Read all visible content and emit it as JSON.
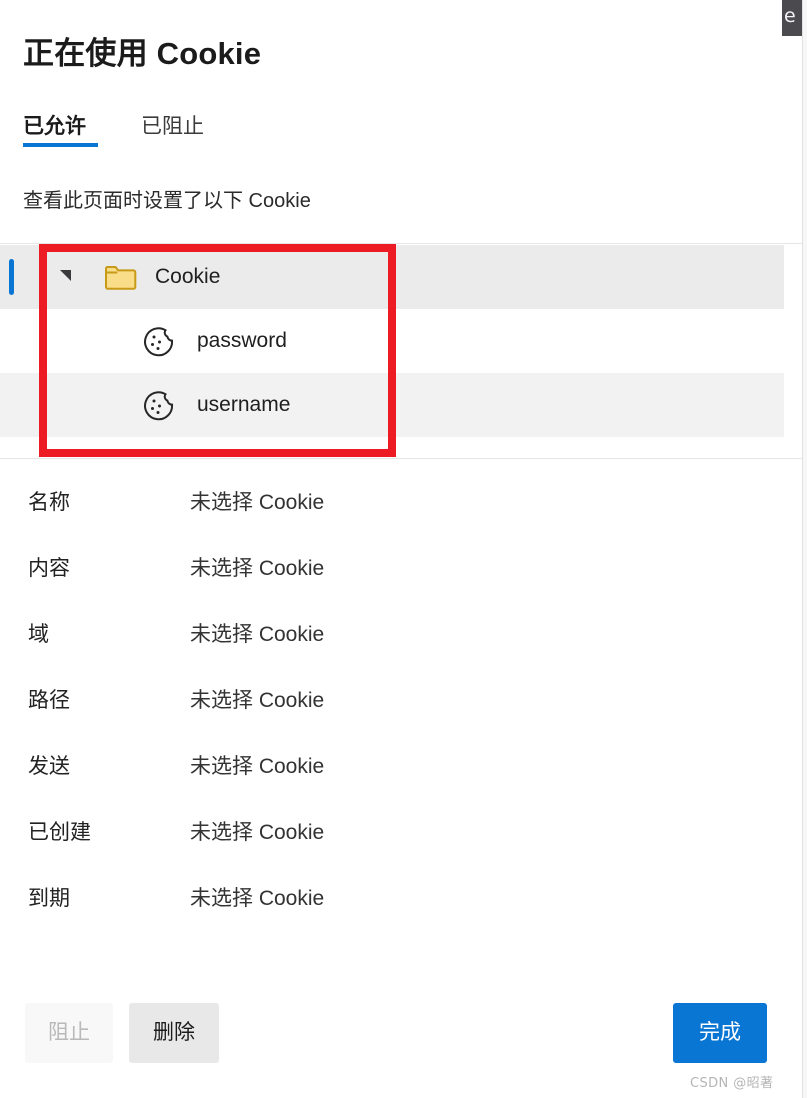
{
  "window": {
    "title": "正在使用 Cookie",
    "browser_sliver_glyph": "e"
  },
  "tabs": [
    {
      "label": "已允许",
      "active": true
    },
    {
      "label": "已阻止",
      "active": false
    }
  ],
  "description": "查看此页面时设置了以下 Cookie",
  "tree": {
    "rows": [
      {
        "label": "Cookie",
        "icon": "folder-icon",
        "level": 0,
        "state": "selected",
        "expanded": true
      },
      {
        "label": "password",
        "icon": "cookie-icon",
        "level": 1,
        "state": "normal",
        "expanded": null
      },
      {
        "label": "username",
        "icon": "cookie-icon",
        "level": 1,
        "state": "hovered",
        "expanded": null
      }
    ]
  },
  "details": [
    {
      "label": "名称",
      "value": "未选择 Cookie"
    },
    {
      "label": "内容",
      "value": "未选择 Cookie"
    },
    {
      "label": "域",
      "value": "未选择 Cookie"
    },
    {
      "label": "路径",
      "value": "未选择 Cookie"
    },
    {
      "label": "发送",
      "value": "未选择 Cookie"
    },
    {
      "label": "已创建",
      "value": "未选择 Cookie"
    },
    {
      "label": "到期",
      "value": "未选择 Cookie"
    }
  ],
  "footer": {
    "block_label": "阻止",
    "delete_label": "删除",
    "done_label": "完成"
  },
  "watermark": "CSDN @昭著",
  "colors": {
    "accent": "#0a76d4",
    "annotation": "#ed1c24",
    "folder": "#f7d57a",
    "selected_row": "#ebebeb",
    "hovered_row": "#f2f2f2"
  }
}
